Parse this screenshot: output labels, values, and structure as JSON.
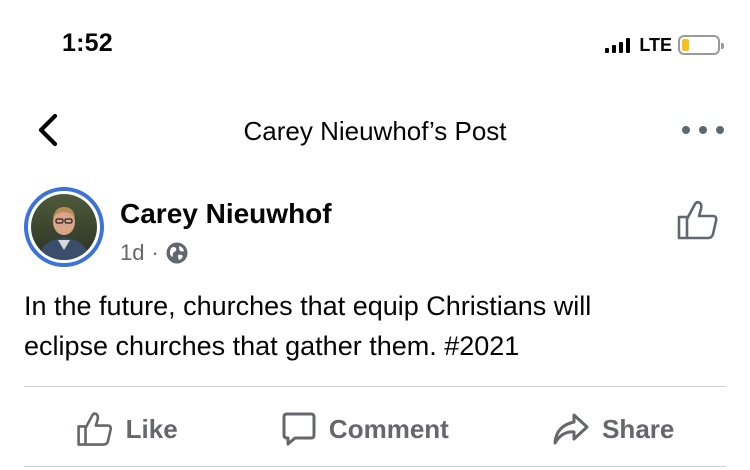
{
  "status_bar": {
    "time": "1:52",
    "network": "LTE",
    "battery_level": 0.22,
    "battery_color": "#f5c21b"
  },
  "nav": {
    "back_icon": "chevron-left-icon",
    "title": "Carey Nieuwhof’s Post",
    "more_icon": "more-dots-icon"
  },
  "post": {
    "author": "Carey Nieuwhof",
    "time": "1d",
    "separator": "·",
    "audience_icon": "globe-icon",
    "text_line1": "In the future, churches that equip Christians will",
    "text_line2": "eclipse churches that gather them.  #2021",
    "avatar_ring_color": "#3b73d9"
  },
  "actions": {
    "like": "Like",
    "comment": "Comment",
    "share": "Share"
  }
}
